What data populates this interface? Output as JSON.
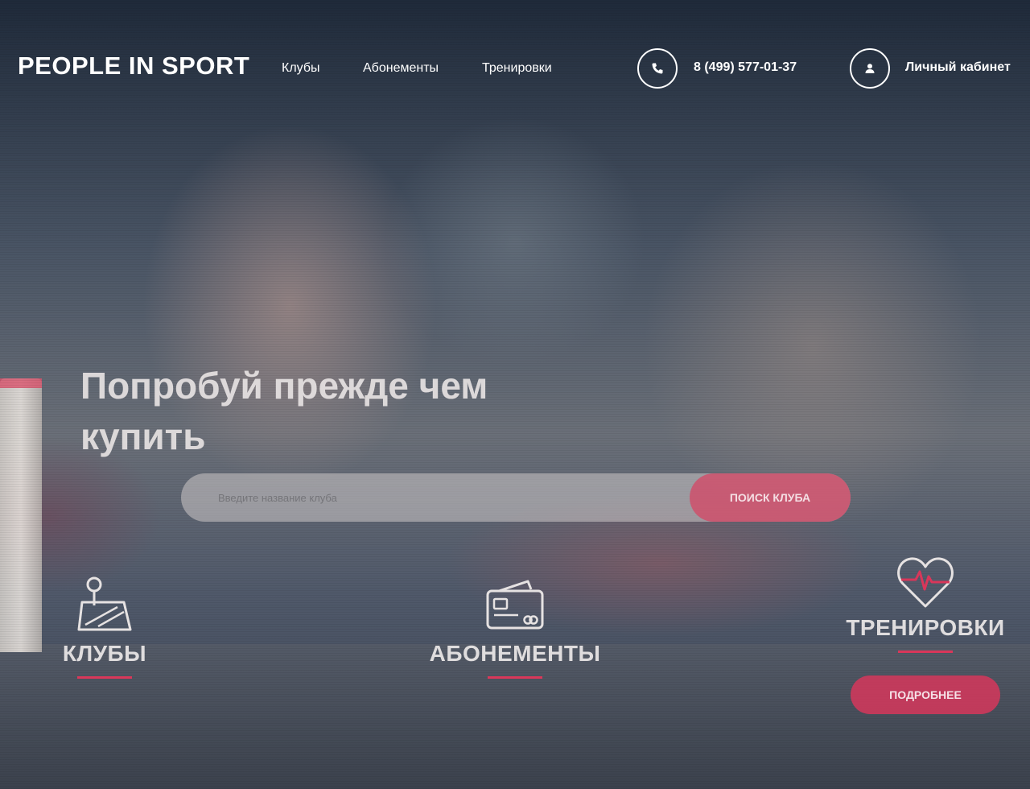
{
  "header": {
    "logo": "PEOPLE IN SPORT",
    "nav": [
      "Клубы",
      "Абонементы",
      "Тренировки"
    ],
    "phone": "8 (499) 577-01-37",
    "cabinet": "Личный кабинет",
    "phone_icon": "phone-icon",
    "user_icon": "user-icon"
  },
  "hero": {
    "headline": "Попробуй прежде чем купить",
    "search": {
      "placeholder": "Введите название клуба",
      "button": "ПОИСК КЛУБА"
    }
  },
  "features": [
    {
      "title": "КЛУБЫ",
      "icon": "map-pin-icon"
    },
    {
      "title": "АБОНЕМЕНТЫ",
      "icon": "card-icon"
    },
    {
      "title": "ТРЕНИРОВКИ",
      "icon": "heart-pulse-icon",
      "button": "ПОДРОБНЕЕ"
    }
  ],
  "colors": {
    "accent": "#d9375a",
    "text": "#ffffff"
  }
}
